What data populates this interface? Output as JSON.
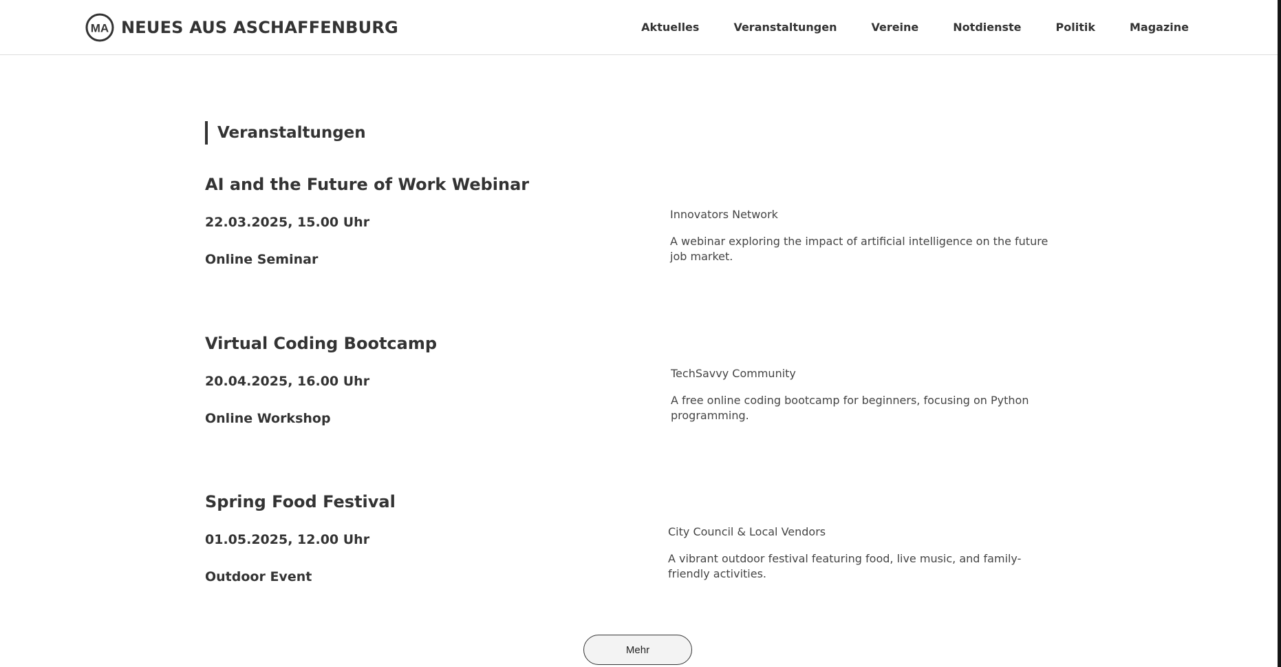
{
  "header": {
    "brand": {
      "logo_icon": "ma-circle-logo",
      "logo_text": "MA",
      "name": "NEUES AUS ASCHAFFENBURG"
    },
    "nav": [
      {
        "label": "Aktuelles"
      },
      {
        "label": "Veranstaltungen"
      },
      {
        "label": "Vereine"
      },
      {
        "label": "Notdienste"
      },
      {
        "label": "Politik"
      },
      {
        "label": "Magazine"
      }
    ]
  },
  "main": {
    "section_title": "Veranstaltungen",
    "events": [
      {
        "title": "AI and the Future of Work Webinar",
        "date": "22.03.2025, 15.00 Uhr",
        "type": "Online Seminar",
        "organizer": "Innovators Network",
        "description": "A webinar exploring the impact of artificial intelligence on the future job market."
      },
      {
        "title": "Virtual Coding Bootcamp",
        "date": "20.04.2025, 16.00 Uhr",
        "type": "Online Workshop",
        "organizer": "TechSavvy Community",
        "description": "A free online coding bootcamp for beginners, focusing on Python programming."
      },
      {
        "title": "Spring Food Festival",
        "date": "01.05.2025, 12.00 Uhr",
        "type": "Outdoor Event",
        "organizer": "City Council & Local Vendors",
        "description": "A vibrant outdoor festival featuring food, live music, and family-friendly activities."
      }
    ],
    "more_label": "Mehr"
  },
  "colors": {
    "text": "#333333",
    "muted_text": "#444444",
    "background": "#ffffff",
    "header_border": "#dcdcdc",
    "button_bg": "#f3f3f3"
  }
}
